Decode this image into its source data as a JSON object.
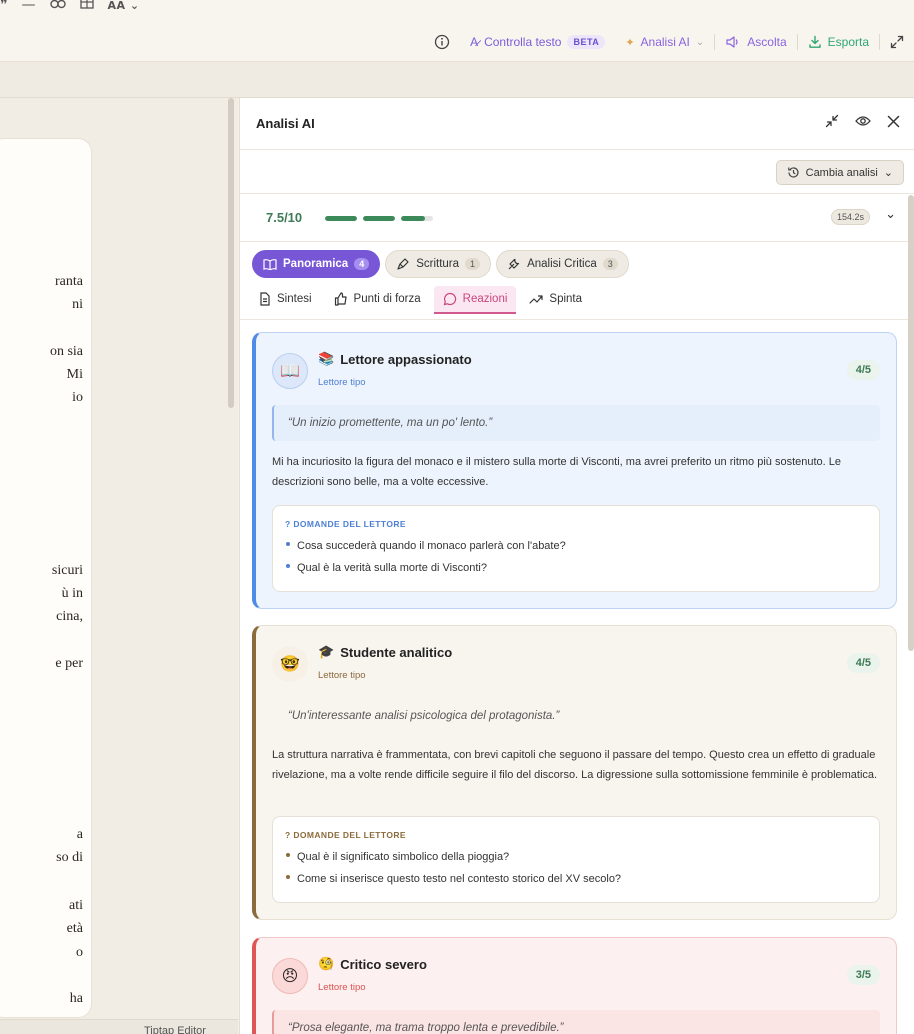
{
  "toolbar": {
    "left_icons": [
      "quote-icon",
      "divider-icon",
      "link-icon",
      "table-icon",
      "font-size-icon"
    ],
    "font_size_label": "AA",
    "check_text_label": "Controlla testo",
    "beta_badge": "BETA",
    "ai_analysis_label": "Analisi AI",
    "listen_label": "Ascolta",
    "export_label": "Esporta"
  },
  "editor": {
    "fragments": [
      "ranta",
      "ni",
      "on sia",
      "Mi",
      "io",
      "sicuri",
      "ù in",
      "cina,",
      "e per",
      "a",
      "so di",
      "ati",
      "età",
      "o",
      "ha"
    ],
    "footer_text": "Tiptap Editor"
  },
  "panel": {
    "title": "Analisi AI",
    "change_analysis_label": "Cambia analisi",
    "score": "7.5/10",
    "progress": [
      1.0,
      1.0,
      0.75
    ],
    "time": "154.2s",
    "tabs": [
      {
        "label": "Panoramica",
        "count": "4",
        "active": true
      },
      {
        "label": "Scrittura",
        "count": "1",
        "active": false
      },
      {
        "label": "Analisi Critica",
        "count": "3",
        "active": false
      }
    ],
    "subtabs": [
      {
        "label": "Sintesi",
        "active": false
      },
      {
        "label": "Punti di forza",
        "active": false
      },
      {
        "label": "Reazioni",
        "active": true
      },
      {
        "label": "Spinta",
        "active": false
      }
    ],
    "reactions": [
      {
        "name": "Lettore appassionato",
        "role": "Lettore tipo",
        "rating": "4/5",
        "quote": "“Un inizio promettente, ma un po' lento.”",
        "text": "Mi ha incuriosito la figura del monaco e il mistero sulla morte di Visconti, ma avrei preferito un ritmo più sostenuto. Le descrizioni sono belle, ma a volte eccessive.",
        "questions_header": "DOMANDE DEL LETTORE",
        "questions": [
          "Cosa succederà quando il monaco parlerà con l'abate?",
          "Qual è la verità sulla morte di Visconti?"
        ]
      },
      {
        "name": "Studente analitico",
        "role": "Lettore tipo",
        "rating": "4/5",
        "quote": "“Un'interessante analisi psicologica del protagonista.”",
        "text": "La struttura narrativa è frammentata, con brevi capitoli che seguono il passare del tempo. Questo crea un effetto di graduale rivelazione, ma a volte rende difficile seguire il filo del discorso. La digressione sulla sottomissione femminile è problematica.",
        "questions_header": "DOMANDE DEL LETTORE",
        "questions": [
          "Qual è il significato simbolico della pioggia?",
          "Come si inserisce questo testo nel contesto storico del XV secolo?"
        ]
      },
      {
        "name": "Critico severo",
        "role": "Lettore tipo",
        "rating": "3/5",
        "quote": "“Prosa elegante, ma trama troppo lenta e prevedibile.”"
      }
    ]
  }
}
